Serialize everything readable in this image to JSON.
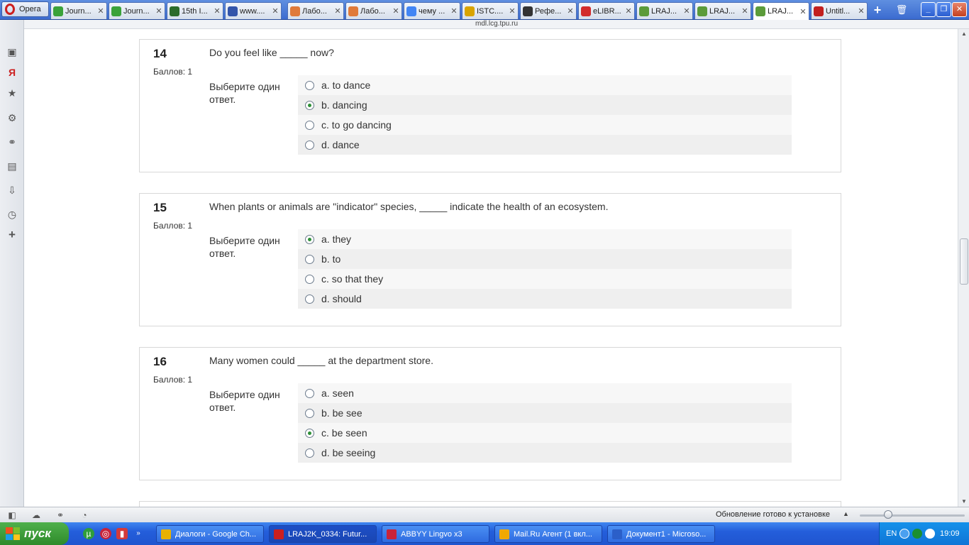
{
  "browser": {
    "menu_label": "Opera",
    "tabs": [
      {
        "label": "Journ...",
        "icon": "green-circle-icon",
        "color": "#3aa23a",
        "active": false
      },
      {
        "label": "Journ...",
        "icon": "green-circle-icon",
        "color": "#3aa23a",
        "active": false
      },
      {
        "label": "15th I...",
        "icon": "leaf-icon",
        "color": "#2b6b2b",
        "active": false
      },
      {
        "label": "www....",
        "icon": "grid-icon",
        "color": "#3355aa",
        "active": false
      },
      {
        "label": "Лабо...",
        "icon": "circle-arrow-icon",
        "color": "#e07a3a",
        "active": false
      },
      {
        "label": "Лабо...",
        "icon": "circle-arrow-icon",
        "color": "#e07a3a",
        "active": false
      },
      {
        "label": "чему ...",
        "icon": "google-icon",
        "color": "#4285f4",
        "active": false
      },
      {
        "label": "ISTC....",
        "icon": "globe-icon",
        "color": "#d9a400",
        "active": false
      },
      {
        "label": "Рефе...",
        "icon": "mortarboard-icon",
        "color": "#333333",
        "active": false
      },
      {
        "label": "eLIBR...",
        "icon": "elibrary-icon",
        "color": "#d22b2b",
        "active": false
      },
      {
        "label": "LRAJ...",
        "icon": "lms-icon",
        "color": "#5b9b3a",
        "active": false
      },
      {
        "label": "LRAJ...",
        "icon": "lms-icon",
        "color": "#5b9b3a",
        "active": false
      },
      {
        "label": "LRAJ...",
        "icon": "lms-icon",
        "color": "#5b9b3a",
        "active": true
      },
      {
        "label": "Untitl...",
        "icon": "untitled-u-icon",
        "color": "#c21f1f",
        "active": false
      }
    ],
    "tab_close_glyph": "✕",
    "address": "mdl.lcg.tpu.ru"
  },
  "quiz": {
    "grade_label": "Баллов: 1",
    "prompt_label": "Выберите один ответ.",
    "questions": [
      {
        "number": "14",
        "text": "Do you feel like _____ now?",
        "answers": [
          {
            "label": "a. to dance",
            "checked": false
          },
          {
            "label": "b. dancing",
            "checked": true
          },
          {
            "label": "c. to go dancing",
            "checked": false
          },
          {
            "label": "d. dance",
            "checked": false
          }
        ]
      },
      {
        "number": "15",
        "text": "When plants or animals are \"indicator\" species, _____ indicate the health of an ecosystem.",
        "answers": [
          {
            "label": "a. they",
            "checked": true
          },
          {
            "label": "b. to",
            "checked": false
          },
          {
            "label": "c. so that they",
            "checked": false
          },
          {
            "label": "d. should",
            "checked": false
          }
        ]
      },
      {
        "number": "16",
        "text": "Many women could _____ at the department store.",
        "answers": [
          {
            "label": "a. seen",
            "checked": false
          },
          {
            "label": "b. be see",
            "checked": false
          },
          {
            "label": "c. be seen",
            "checked": true
          },
          {
            "label": "d. be seeing",
            "checked": false
          }
        ]
      }
    ]
  },
  "statusbar": {
    "update_text": "Обновление готово к установке",
    "zoom_level": 0.25
  },
  "taskbar": {
    "start_label": "пуск",
    "tasks": [
      {
        "label": "Диалоги - Google Ch...",
        "icon": "chrome-icon",
        "color": "#e8b100",
        "active": false
      },
      {
        "label": "LRAJ2K_0334: Futur...",
        "icon": "opera-icon",
        "color": "#cc1f1f",
        "active": true
      },
      {
        "label": "ABBYY Lingvo x3",
        "icon": "book-icon",
        "color": "#c8233a",
        "active": false
      },
      {
        "label": "Mail.Ru Агент (1 вкл...",
        "icon": "mail-icon",
        "color": "#f0a800",
        "active": false
      },
      {
        "label": "Документ1 - Microso...",
        "icon": "word-icon",
        "color": "#2b5fc9",
        "active": false
      }
    ],
    "language": "EN",
    "clock": "19:09"
  }
}
